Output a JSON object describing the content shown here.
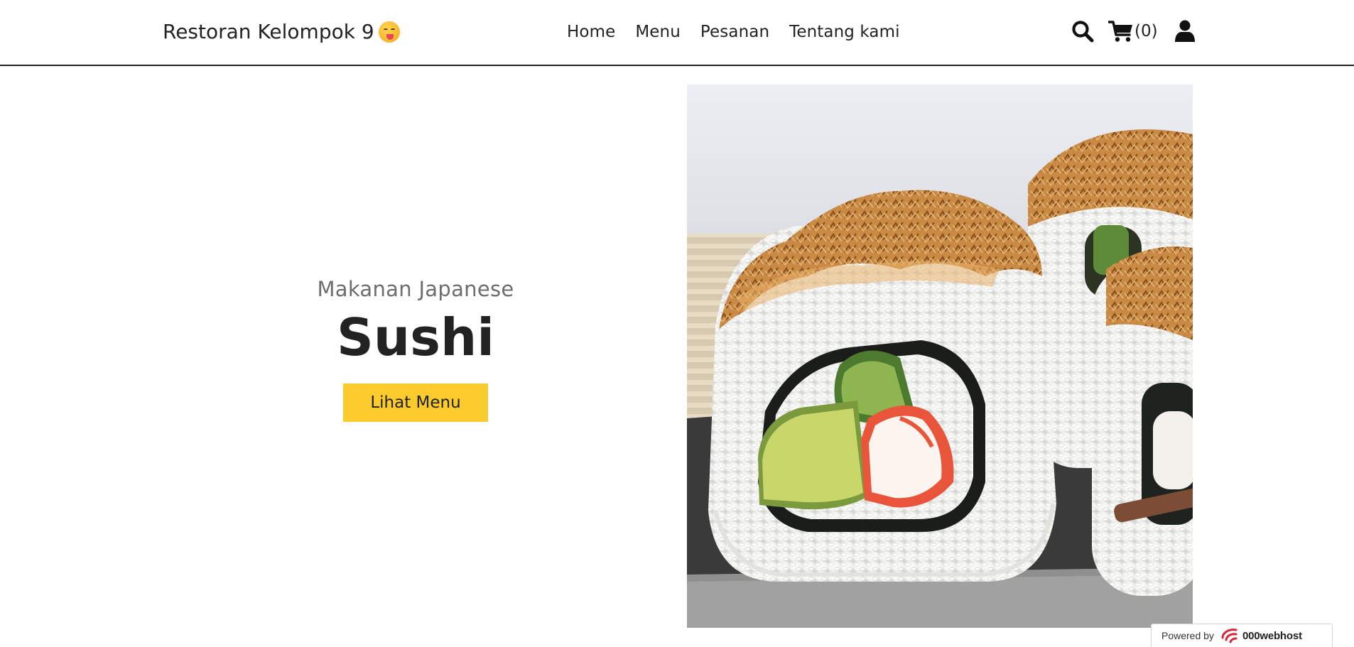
{
  "brand": {
    "name": "Restoran Kelompok 9",
    "emoji_icon": "face-savoring-food-icon"
  },
  "nav": {
    "links": [
      {
        "label": "Home"
      },
      {
        "label": "Menu"
      },
      {
        "label": "Pesanan"
      },
      {
        "label": "Tentang kami"
      }
    ]
  },
  "actions": {
    "search_icon": "search-icon",
    "cart_icon": "cart-icon",
    "cart_count": "(0)",
    "user_icon": "user-icon"
  },
  "hero": {
    "subtitle": "Makanan Japanese",
    "title": "Sushi",
    "cta_label": "Lihat Menu",
    "image_alt": "Sushi roll with crispy fried onion topping, cucumber, avocado and crab stick"
  },
  "footer_badge": {
    "powered_by": "Powered by",
    "host_name": "000webhost"
  },
  "colors": {
    "accent": "#fbcb2d",
    "text": "#222222",
    "subtitle": "#6d6d6d",
    "divider": "#222222"
  }
}
